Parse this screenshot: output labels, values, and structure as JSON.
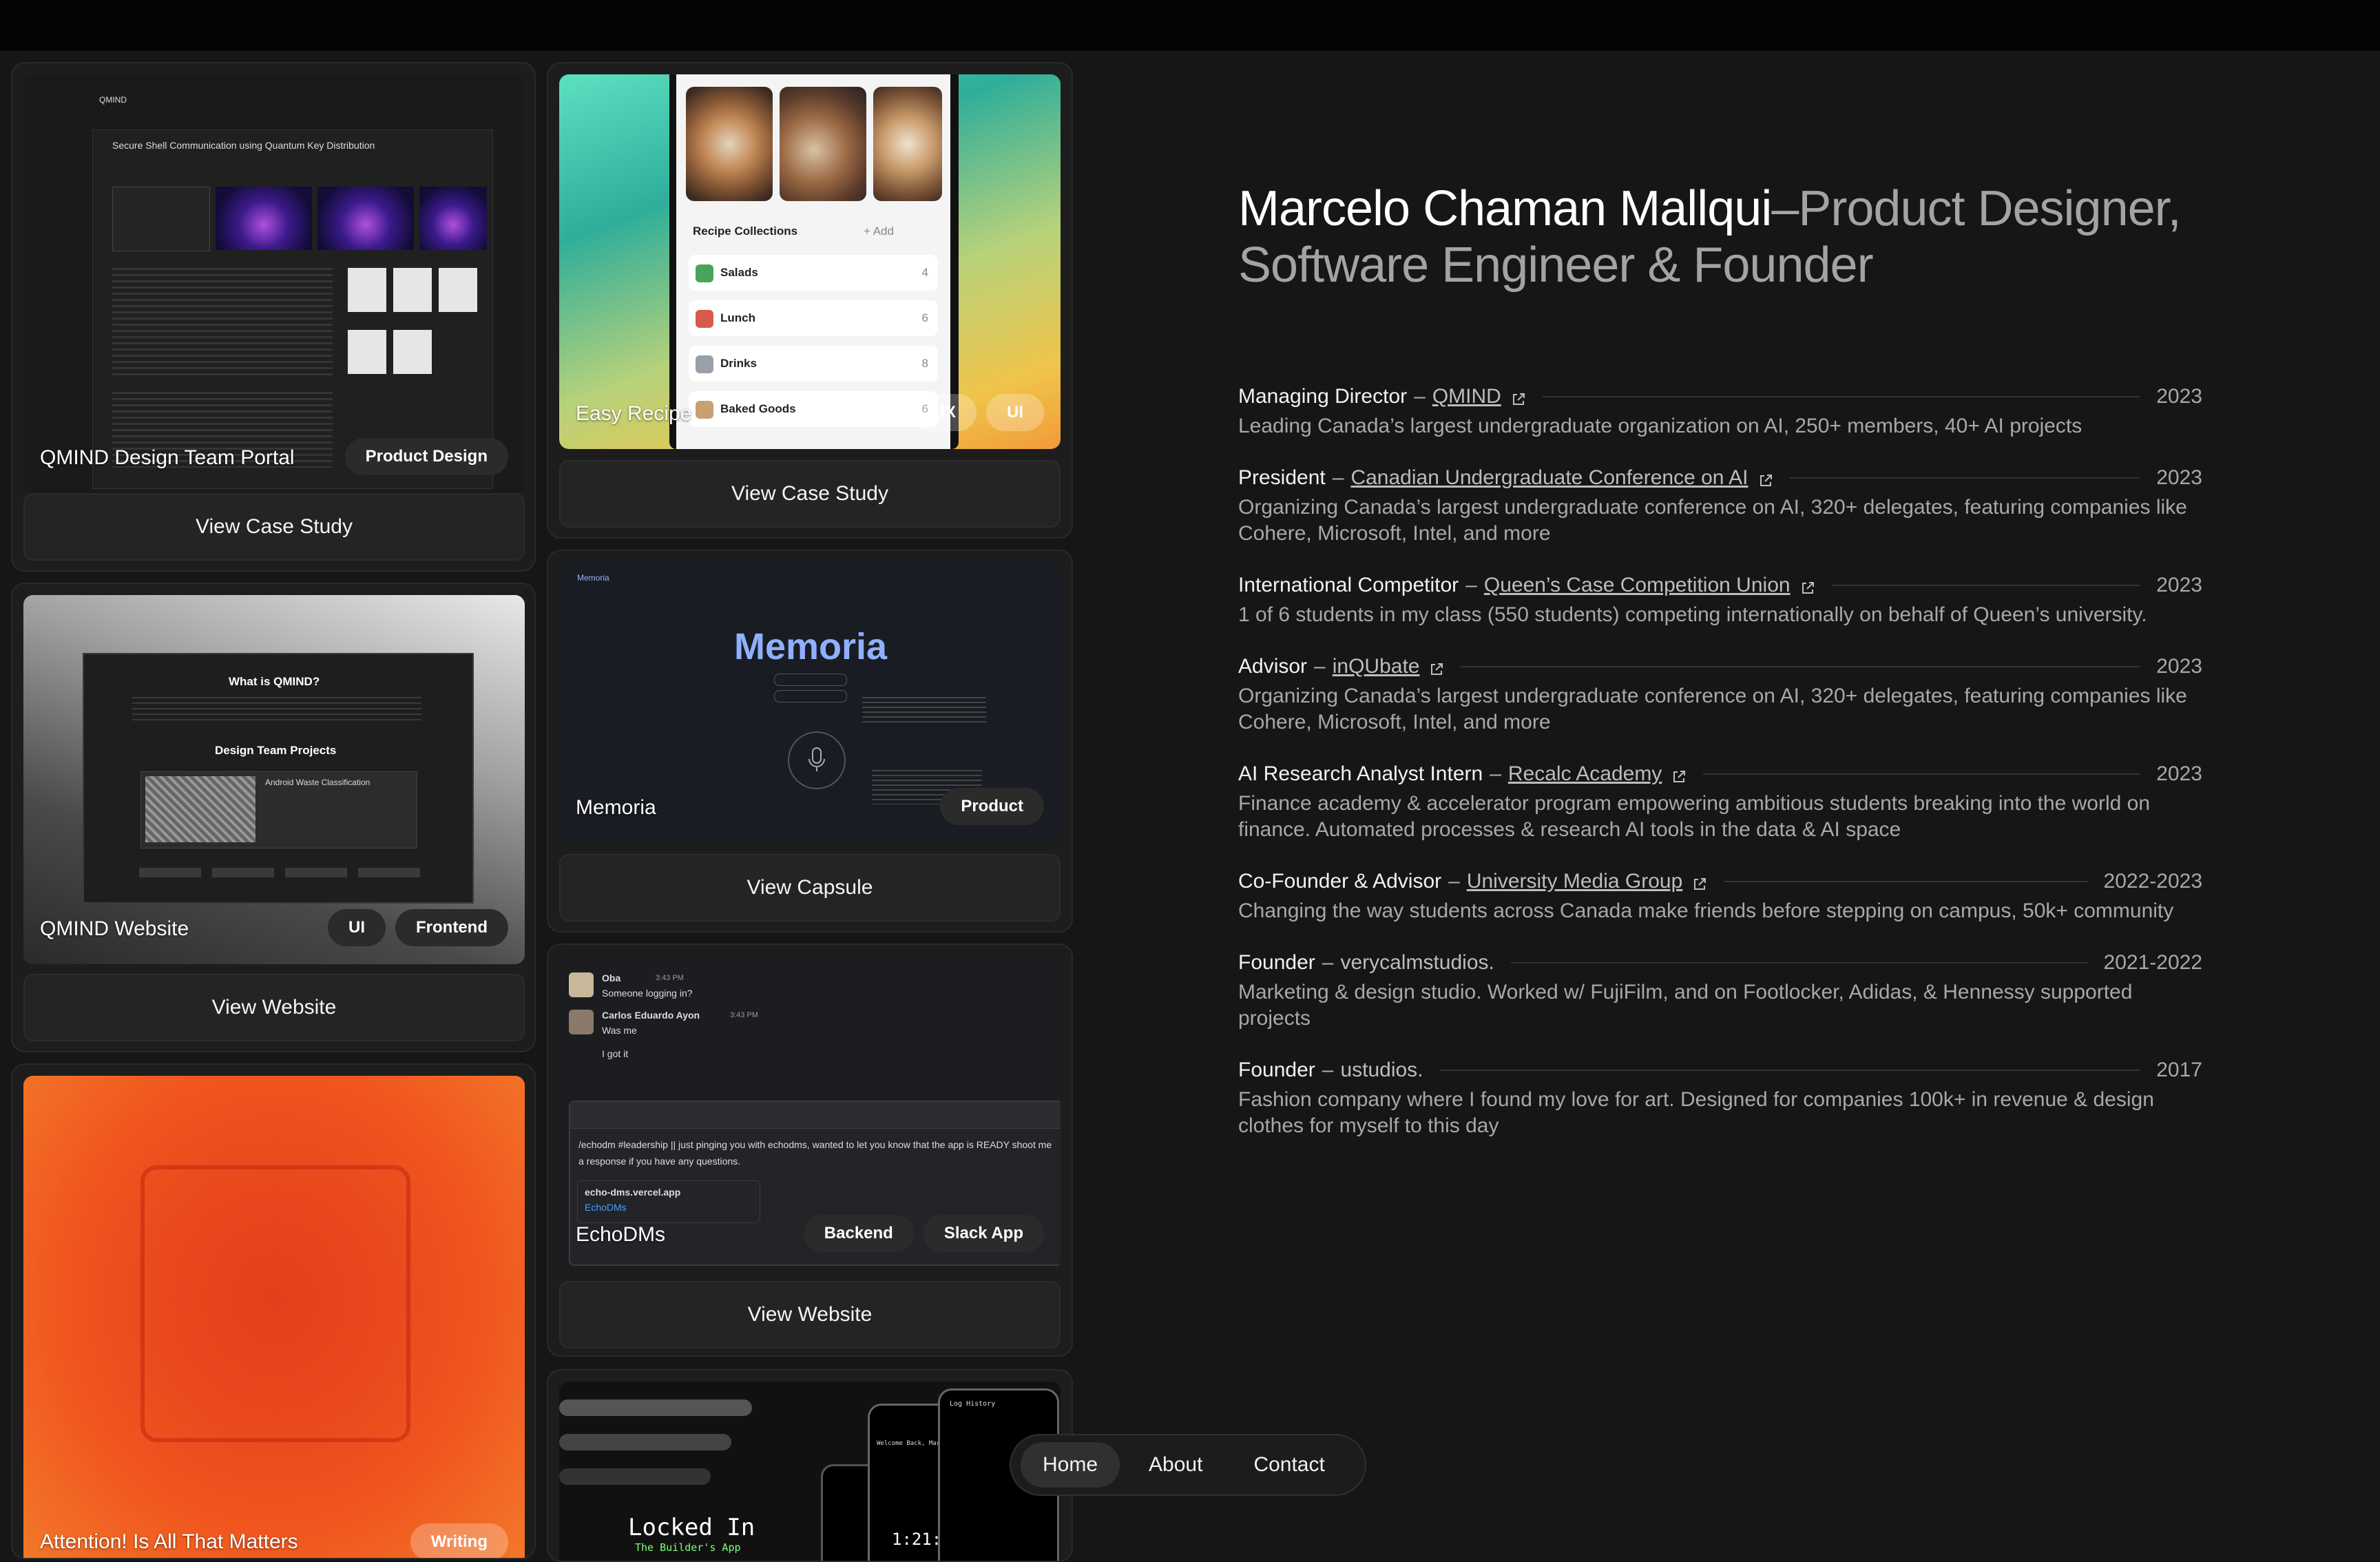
{
  "projects": [
    {
      "title": "QMIND Design Team Portal",
      "tags": [
        "Product Design"
      ],
      "button": "View Case Study",
      "mock": {
        "brand": "QMIND",
        "heading": "Secure Shell Communication using Quantum Key Distribution"
      }
    },
    {
      "title": "Easy Recipe",
      "tags": [
        "UX",
        "UI"
      ],
      "button": "View Case Study",
      "mock": {
        "section": "Recipe Collections",
        "add": "+ Add",
        "items": [
          {
            "name": "Salads",
            "count": "4"
          },
          {
            "name": "Lunch",
            "count": "6"
          },
          {
            "name": "Drinks",
            "count": "8"
          },
          {
            "name": "Baked Goods",
            "count": "6"
          }
        ]
      }
    },
    {
      "title": "QMIND Website",
      "tags": [
        "UI",
        "Frontend"
      ],
      "button": "View Website",
      "mock": {
        "heading": "What is QMIND?",
        "sub": "Design Team Projects",
        "card": "Android Waste Classification"
      }
    },
    {
      "title": "Memoria",
      "tags": [
        "Product"
      ],
      "button": "View Capsule",
      "mock": {
        "brand": "Memoria",
        "logo": "Memoria"
      }
    },
    {
      "title": "EchoDMs",
      "tags": [
        "Backend",
        "Slack App"
      ],
      "button": "View Website",
      "mock": {
        "messages": [
          {
            "user": "Oba",
            "time": "3:43 PM",
            "text": "Someone logging in?"
          },
          {
            "user": "Carlos Eduardo Ayon",
            "time": "3:43 PM",
            "text": "Was me"
          },
          {
            "user": "",
            "time": "",
            "text": "I got it"
          }
        ],
        "compose": "/echodm #leadership || just pinging you with echodms, wanted to let you know that the app is READY shoot me a response if you have any questions.",
        "link": "echo-dms.vercel.app",
        "link_sub": "EchoDMs"
      }
    },
    {
      "title": "Attention! Is All That Matters",
      "tags": [
        "Writing"
      ],
      "button": ""
    },
    {
      "title": "Locked In",
      "subtitle": "The Builder's App",
      "tags": [],
      "button": "",
      "mock": {
        "timer": "1:21:31",
        "log": "Log History",
        "welcome": "Welcome Back, Marcelo"
      }
    }
  ],
  "profile": {
    "name": "Marcelo Chaman Mallqui",
    "role": "–Product Designer, Software Engineer & Founder"
  },
  "experience": [
    {
      "role": "Managing Director",
      "org": "QMIND",
      "link": true,
      "year": "2023",
      "desc": "Leading Canada’s largest undergraduate organization on AI, 250+ members, 40+ AI projects"
    },
    {
      "role": "President",
      "org": "Canadian Undergraduate Conference on AI",
      "link": true,
      "year": "2023",
      "desc": "Organizing Canada’s largest undergraduate conference on AI, 320+ delegates, featuring companies like Cohere, Microsoft, Intel, and more"
    },
    {
      "role": "International Competitor",
      "org": "Queen’s Case Competition Union",
      "link": true,
      "year": "2023",
      "desc": "1 of 6 students in my class (550 students) competing internationally on behalf of Queen’s university."
    },
    {
      "role": "Advisor",
      "org": "inQUbate",
      "link": true,
      "year": "2023",
      "desc": "Organizing Canada’s largest undergraduate conference on AI, 320+ delegates, featuring companies like Cohere, Microsoft, Intel, and more"
    },
    {
      "role": "AI Research Analyst Intern",
      "org": "Recalc Academy",
      "link": true,
      "year": "2023",
      "desc": "Finance academy & accelerator program empowering ambitious students breaking into the world on finance. Automated processes & research AI tools in the data & AI space"
    },
    {
      "role": "Co-Founder & Advisor",
      "org": "University Media Group",
      "link": true,
      "year": "2022-2023",
      "desc": "Changing the way students across Canada make friends before stepping on campus, 50k+ community"
    },
    {
      "role": "Founder",
      "org": "verycalmstudios.",
      "link": false,
      "year": "2021-2022",
      "desc": "Marketing & design studio. Worked w/ FujiFilm, and on Footlocker, Adidas, & Hennessy supported projects"
    },
    {
      "role": "Founder",
      "org": "ustudios.",
      "link": false,
      "year": "2017",
      "desc": "Fashion company where I found my love for art. Designed for companies 100k+ in revenue & design clothes for myself to this day"
    }
  ],
  "nav": [
    {
      "label": "Home",
      "active": true
    },
    {
      "label": "About",
      "active": false
    },
    {
      "label": "Contact",
      "active": false
    }
  ],
  "colors": {
    "background": "#161616",
    "card": "#1d1d1d",
    "accent_orange": "#f0561e",
    "muted": "#a8a8a8"
  }
}
